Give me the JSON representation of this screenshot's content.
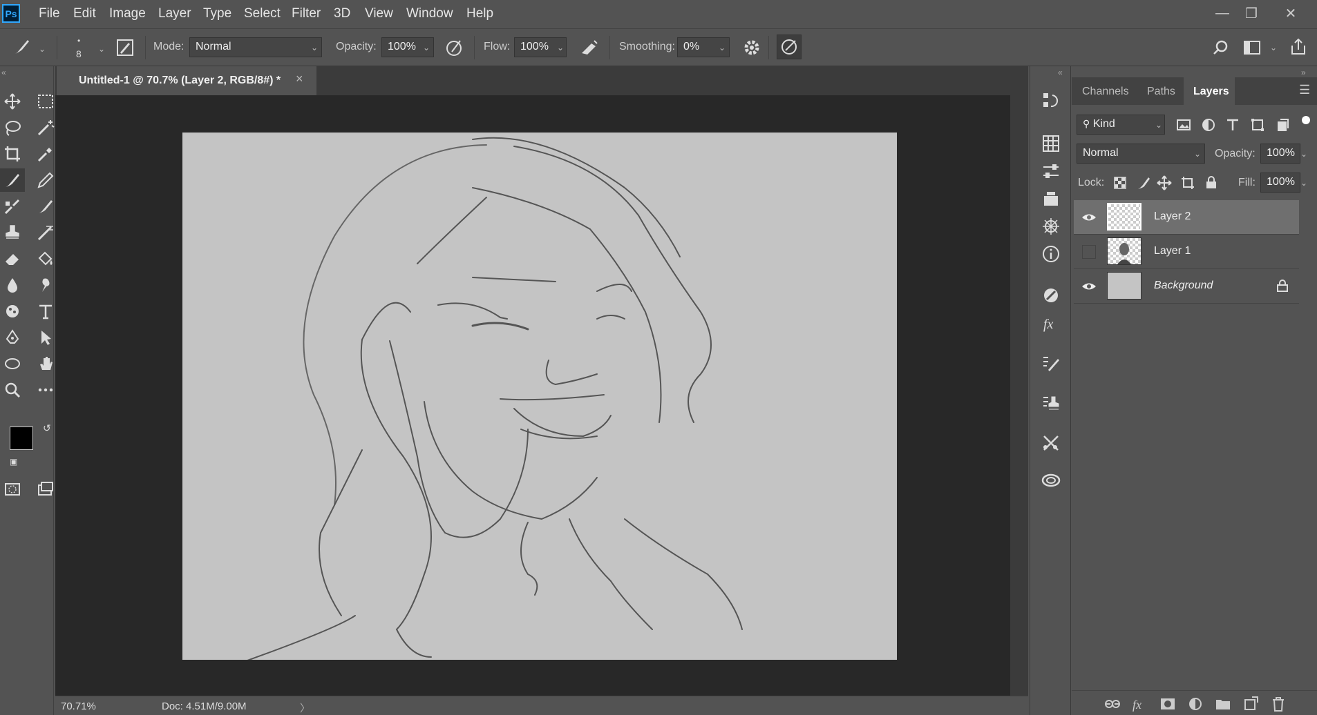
{
  "app": {
    "logo": "Ps"
  },
  "menu": [
    "File",
    "Edit",
    "Image",
    "Layer",
    "Type",
    "Select",
    "Filter",
    "3D",
    "View",
    "Window",
    "Help"
  ],
  "options": {
    "brush_size": "8",
    "mode_label": "Mode:",
    "mode_value": "Normal",
    "opacity_label": "Opacity:",
    "opacity_value": "100%",
    "flow_label": "Flow:",
    "flow_value": "100%",
    "smoothing_label": "Smoothing:",
    "smoothing_value": "0%"
  },
  "document": {
    "tab_title": "Untitled-1 @ 70.7% (Layer 2, RGB/8#) *",
    "close": "×"
  },
  "status": {
    "zoom": "70.71%",
    "doc": "Doc: 4.51M/9.00M",
    "arrow": "〉"
  },
  "panel": {
    "tabs": [
      "Channels",
      "Paths",
      "Layers"
    ],
    "active_tab": "Layers",
    "filter_kind": "Kind",
    "blend_mode": "Normal",
    "opacity_label": "Opacity:",
    "opacity_value": "100%",
    "lock_label": "Lock:",
    "fill_label": "Fill:",
    "fill_value": "100%",
    "layers": [
      {
        "name": "Layer 2",
        "visible": true,
        "selected": true
      },
      {
        "name": "Layer 1",
        "visible": false,
        "selected": false
      },
      {
        "name": "Background",
        "visible": true,
        "selected": false,
        "locked": true
      }
    ]
  },
  "colors": {
    "foreground": "#000000",
    "background": "#0f2a2a",
    "canvas": "#c4c4c4",
    "ui": "#535353"
  },
  "icons": {
    "tools": [
      "move-icon",
      "marquee-icon",
      "lasso-icon",
      "magic-wand-icon",
      "crop-icon",
      "eyedropper-icon",
      "brush-icon",
      "pencil-icon",
      "healing-brush-icon",
      "history-brush-icon",
      "stamp-icon",
      "art-brush-icon",
      "eraser-icon",
      "paint-bucket-icon",
      "blur-icon",
      "smudge-icon",
      "sponge-icon",
      "type-icon",
      "pen-icon",
      "path-select-icon",
      "ellipse-icon",
      "hand-icon",
      "zoom-icon",
      "more-tools-icon"
    ]
  }
}
